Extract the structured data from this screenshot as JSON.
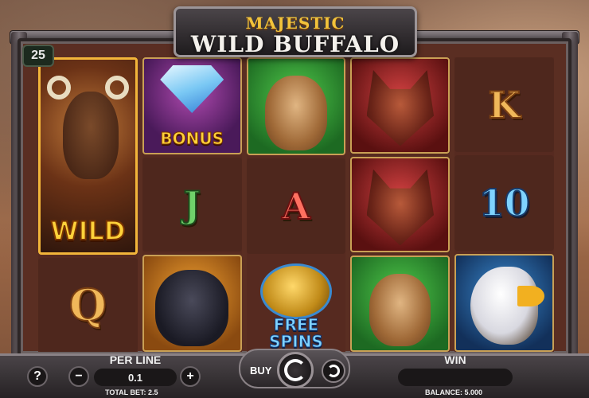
{
  "game": {
    "title_top": "MAJESTIC",
    "title_main": "WILD BUFFALO",
    "lines_count": "25"
  },
  "reels": [
    [
      "WILD",
      "Q"
    ],
    [
      "BONUS",
      "J",
      "bear"
    ],
    [
      "puma",
      "A",
      "FREE SPINS"
    ],
    [
      "wolf",
      "wolves",
      "puma"
    ],
    [
      "K",
      "10",
      "eagle"
    ]
  ],
  "symbols": {
    "wild_label": "WILD",
    "bonus_label": "BONUS",
    "free_label": "FREE",
    "spins_label": "SPINS",
    "q": "Q",
    "j": "J",
    "a": "A",
    "k": "K",
    "ten": "10"
  },
  "controls": {
    "help": "?",
    "minus": "−",
    "plus": "+",
    "per_line_label": "PER LINE",
    "per_line_value": "0.1",
    "total_bet": "TOTAL BET: 2.5",
    "buy_label": "BUY",
    "win_label": "WIN",
    "win_value": "",
    "balance": "BALANCE: 5.000"
  },
  "colors": {
    "gold": "#f2b53a",
    "frame": "#5a2e22",
    "bar": "#262224"
  }
}
